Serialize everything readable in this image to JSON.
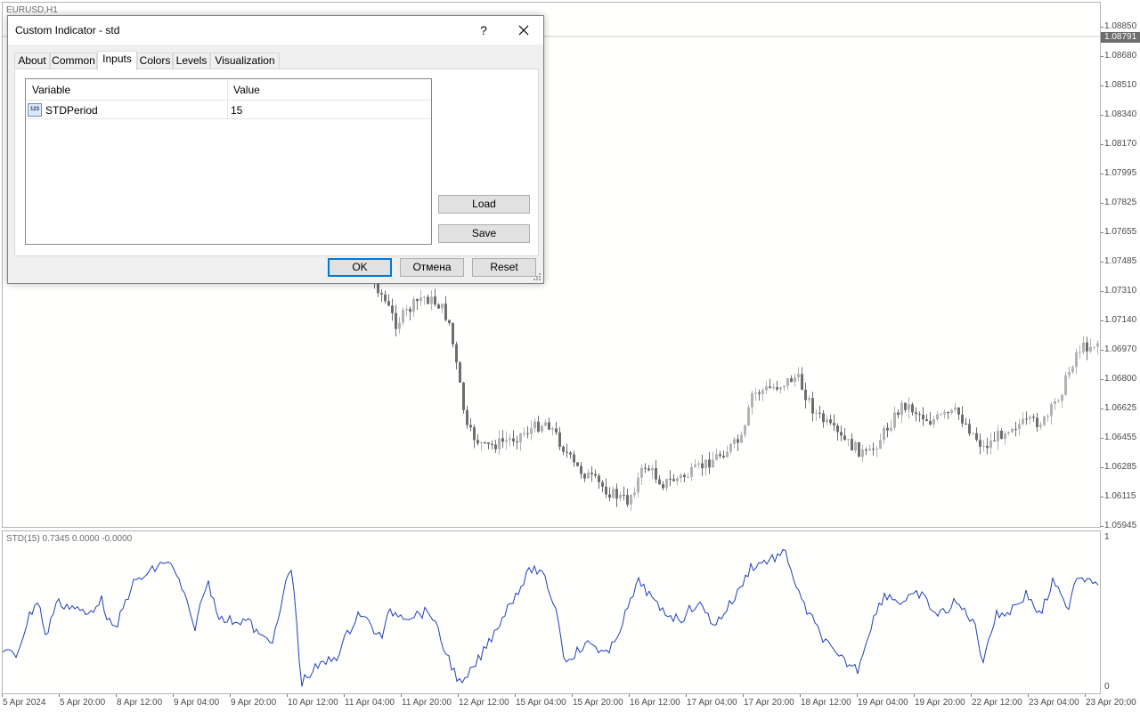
{
  "chart": {
    "symbol": "EURUSD,H1",
    "current_price": "1.08791",
    "price_labels": [
      "1.08850",
      "1.08680",
      "1.08510",
      "1.08340",
      "1.08170",
      "1.07995",
      "1.07825",
      "1.07655",
      "1.07485",
      "1.07310",
      "1.07140",
      "1.06970",
      "1.06800",
      "1.06625",
      "1.06455",
      "1.06285",
      "1.06115",
      "1.05945"
    ],
    "time_labels": [
      "5 Apr 2024",
      "5 Apr 20:00",
      "8 Apr 12:00",
      "9 Apr 04:00",
      "9 Apr 20:00",
      "10 Apr 12:00",
      "11 Apr 04:00",
      "11 Apr 20:00",
      "12 Apr 12:00",
      "15 Apr 04:00",
      "15 Apr 20:00",
      "16 Apr 12:00",
      "17 Apr 04:00",
      "17 Apr 20:00",
      "18 Apr 12:00",
      "19 Apr 04:00",
      "19 Apr 20:00",
      "22 Apr 12:00",
      "23 Apr 04:00",
      "23 Apr 20:00"
    ],
    "indicator_label": "STD(15) 0.7345 0.0000 -0.0000",
    "indicator_axis_top": "1",
    "indicator_axis_bottom": "0",
    "colors": {
      "bull": "#b3b3b3",
      "bear": "#6e6e6e",
      "indicator_line": "#1f3fb8"
    }
  },
  "dialog": {
    "title": "Custom Indicator - std",
    "help_label": "?",
    "close_label": "✕",
    "tabs": [
      "About",
      "Common",
      "Inputs",
      "Colors",
      "Levels",
      "Visualization"
    ],
    "active_tab": "Inputs",
    "grid": {
      "headers": [
        "Variable",
        "Value"
      ],
      "rows": [
        {
          "icon": "123",
          "variable": "STDPeriod",
          "value": "15"
        }
      ]
    },
    "load_label": "Load",
    "save_label": "Save",
    "ok_label": "OK",
    "cancel_label": "Отмена",
    "reset_label": "Reset"
  }
}
